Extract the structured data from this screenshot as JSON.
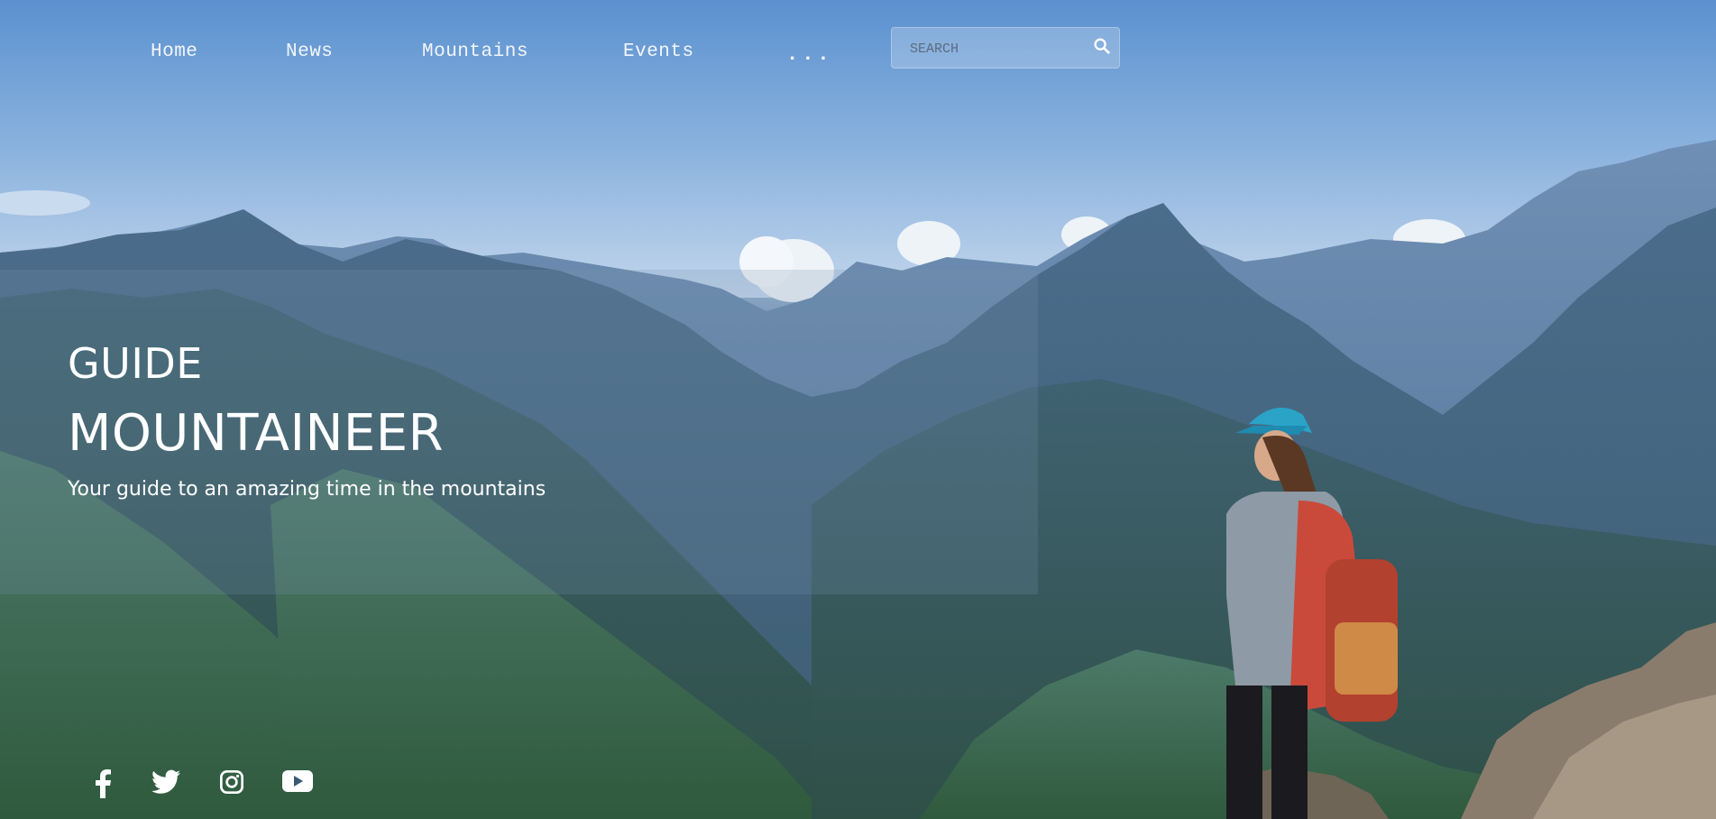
{
  "nav": {
    "home": "Home",
    "news": "News",
    "mountains": "Mountains",
    "events": "Events",
    "more": "..."
  },
  "search": {
    "placeholder": "SEARCH",
    "icon": "search-icon"
  },
  "hero": {
    "title_small": "GUIDE",
    "title_big": "MOUNTAINEER",
    "subtitle": "Your guide to an amazing time in the mountains"
  },
  "social": {
    "icons": [
      "facebook-icon",
      "twitter-icon",
      "instagram-icon",
      "youtube-icon"
    ]
  },
  "colors": {
    "sky": "#7fa9d8",
    "mountain": "#3d6079",
    "text": "#ffffff"
  }
}
